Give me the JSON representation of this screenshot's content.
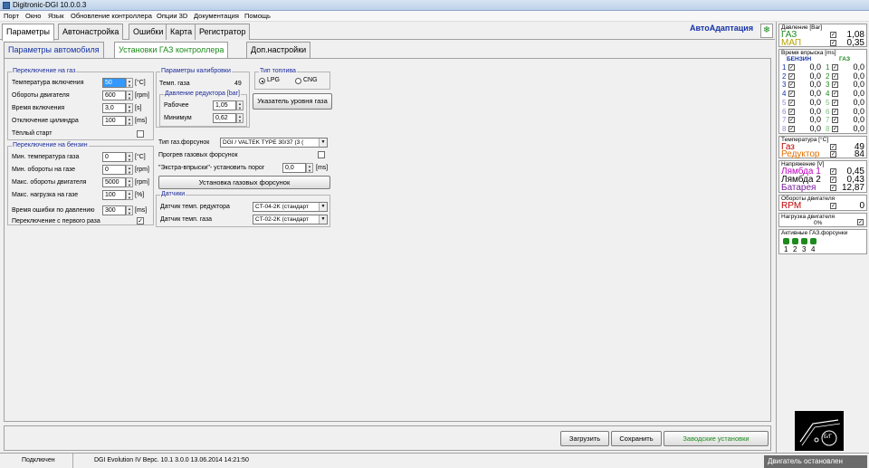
{
  "titlebar": {
    "title": "Digitronic-DGI  10.0.0.3"
  },
  "menu": [
    "Порт",
    "Окно",
    "Язык",
    "Обновление контроллера",
    "Опции 3D",
    "Документация",
    "Помощь"
  ],
  "main_tabs": [
    "Параметры",
    "Автонастройка",
    "Ошибки",
    "Карта",
    "Регистратор"
  ],
  "autoadapt": "АвтоАдаптация",
  "sub_tabs": [
    "Параметры автомобиля",
    "Установки ГАЗ контроллера",
    "Доп.настройки"
  ],
  "switch_gas": {
    "title": "Переключение на газ",
    "temp_label": "Температура включения",
    "temp_value": "50",
    "temp_unit": "[°C]",
    "rpm_label": "Обороты двигателя",
    "rpm_value": "600",
    "rpm_unit": "[rpm]",
    "time_label": "Время включения",
    "time_value": "3,0",
    "time_unit": "[s]",
    "cyl_label": "Отключение цилиндра",
    "cyl_value": "100",
    "cyl_unit": "[ms]",
    "warm_label": "Тёплый старт"
  },
  "switch_petrol": {
    "title": "Переключение на бензин",
    "mintemp_label": "Мин. температура газа",
    "mintemp_value": "0",
    "mintemp_unit": "[°C]",
    "minrpm_label": "Мин. обороты на газе",
    "minrpm_value": "0",
    "minrpm_unit": "[rpm]",
    "maxrpm_label": "Макс. обороты двигателя",
    "maxrpm_value": "5000",
    "maxrpm_unit": "[rpm]",
    "maxload_label": "Макс. нагрузка на газе",
    "maxload_value": "100",
    "maxload_unit": "[%]",
    "errtime_label": "Время ошибки по давлению",
    "errtime_value": "300",
    "errtime_unit": "[ms]",
    "firstgear_label": "Переключение с первого раза"
  },
  "calib": {
    "title": "Параметры калибровки",
    "gastemp_label": "Темп. газа",
    "gastemp_value": "49",
    "pressure_title": "Давление редуктора [bar]",
    "work_label": "Рабочее",
    "work_value": "1,05",
    "min_label": "Минимум",
    "min_value": "0,62"
  },
  "fuel": {
    "title": "Тип топлива",
    "lpg": "LPG",
    "cng": "CNG"
  },
  "level_btn": "Указатель уровня газа",
  "injector_type_label": "Тип газ.форсунок",
  "injector_type_value": "DGI / VALTEK TYPE 30/37 (3 (",
  "preheat_label": "Прогрев газовых форсунок",
  "extra_label": "\"Экстра-впрыски\"- установить порог",
  "extra_value": "0,0",
  "extra_unit": "[ms]",
  "install_btn": "Установка газовых форсунок",
  "sensors": {
    "title": "Датчики",
    "reducer_label": "Датчик темп. редуктора",
    "reducer_value": "CT-04-2K (стандарт",
    "gas_label": "Датчик темп. газа",
    "gas_value": "CT-02-2K (стандарт"
  },
  "bottom": {
    "load": "Загрузить",
    "save": "Сохранить",
    "factory": "Заводские установки"
  },
  "status": {
    "connected": "Подключен",
    "info": "DGI Evolution IV  Верс. 10.1  3.0.0   13.06.2014 14:21:50",
    "engine": "Двигатель остановлен"
  },
  "right": {
    "pressure_title": "Давление [Bar]",
    "gas_label": "ГАЗ",
    "gas_value": "1,08",
    "map_label": "МАП",
    "map_value": "0,35",
    "inj_title": "Время впрыска [ms]",
    "petrol_col": "БЕНЗИН",
    "gas_col": "ГАЗ",
    "inj_rows": [
      {
        "n": "1",
        "p": "0,0",
        "g": "0,0"
      },
      {
        "n": "2",
        "p": "0,0",
        "g": "0,0"
      },
      {
        "n": "3",
        "p": "0,0",
        "g": "0,0"
      },
      {
        "n": "4",
        "p": "0,0",
        "g": "0,0"
      },
      {
        "n": "5",
        "p": "0,0",
        "g": "0,0"
      },
      {
        "n": "6",
        "p": "0,0",
        "g": "0,0"
      },
      {
        "n": "7",
        "p": "0,0",
        "g": "0,0"
      },
      {
        "n": "8",
        "p": "0,0",
        "g": "0,0"
      }
    ],
    "temp_title": "Температура [°C]",
    "temp_gas_label": "Газ",
    "temp_gas_value": "49",
    "temp_red_label": "Редуктор",
    "temp_red_value": "84",
    "volt_title": "Напряжение [V]",
    "lambda1_label": "Лямбда 1",
    "lambda1_value": "0,45",
    "lambda2_label": "Лямбда 2",
    "lambda2_value": "0,43",
    "battery_label": "Батарея",
    "battery_value": "12,87",
    "rpm_title": "Обороты двигателя",
    "rpm_label": "RPM",
    "rpm_value": "0",
    "load_title": "Нагрузка двигателя",
    "load_value": "0%",
    "active_title": "Активные ГАЗ.форсунки",
    "active_nums": [
      "1",
      "2",
      "3",
      "4"
    ],
    "logo_text": "Б/Г"
  },
  "colors": {
    "gas": "#1c8a1c",
    "map": "#b5a200",
    "red": "#c00000",
    "magenta": "#c000c0",
    "blue": "#1432a8",
    "group_title": "#1c2c9c"
  }
}
